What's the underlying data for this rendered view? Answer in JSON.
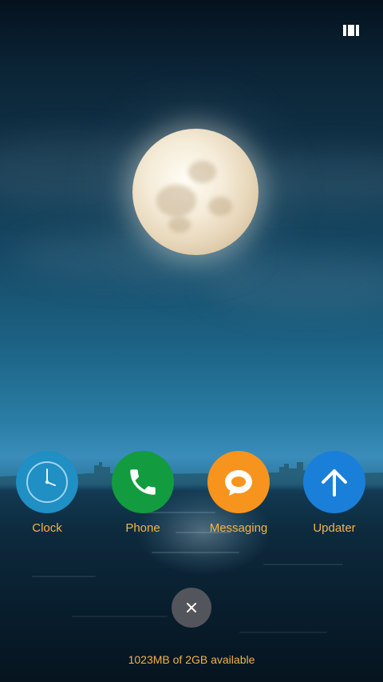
{
  "status_bar": {
    "icon": "recents-grid-icon"
  },
  "apps": [
    {
      "label": "Clock",
      "icon": "clock-icon",
      "color": "#1f8fc4"
    },
    {
      "label": "Phone",
      "icon": "phone-icon",
      "color": "#129c3f"
    },
    {
      "label": "Messaging",
      "icon": "message-bubble-icon",
      "color": "#f7941d"
    },
    {
      "label": "Updater",
      "icon": "arrow-up-icon",
      "color": "#1a7fd8"
    }
  ],
  "close_button": {
    "icon": "close-icon"
  },
  "memory": {
    "text": "1023MB of 2GB available"
  },
  "colors": {
    "label_accent": "#f2b34a"
  }
}
